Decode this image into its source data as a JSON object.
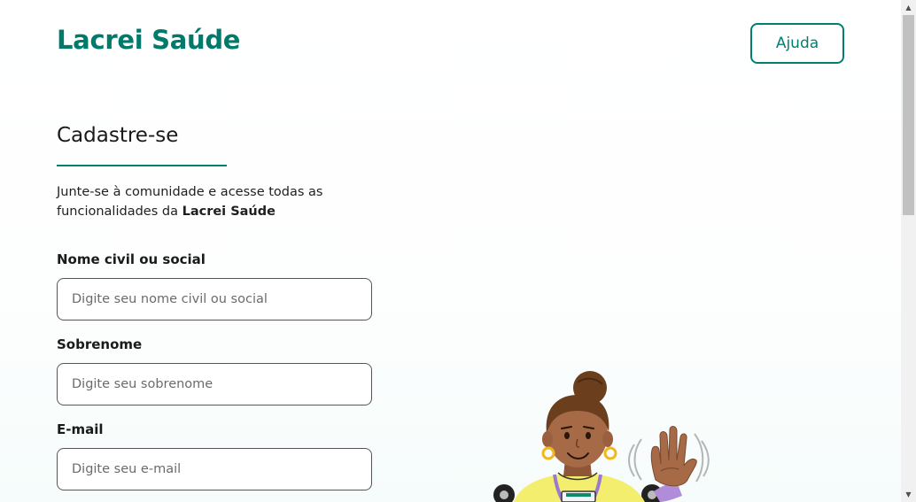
{
  "header": {
    "logo_text": "Lacrei Saúde",
    "help_label": "Ajuda"
  },
  "form": {
    "title": "Cadastre-se",
    "subtitle_prefix": "Junte-se à comunidade e acesse todas as funcionalidades da ",
    "subtitle_brand": "Lacrei Saúde",
    "fields": [
      {
        "label": "Nome civil ou social",
        "placeholder": "Digite seu nome civil ou social",
        "value": ""
      },
      {
        "label": "Sobrenome",
        "placeholder": "Digite seu sobrenome",
        "value": ""
      },
      {
        "label": "E-mail",
        "placeholder": "Digite seu e-mail",
        "value": ""
      }
    ]
  },
  "illustration": {
    "icon": "waving-person-illustration"
  },
  "colors": {
    "brand": "#007a6b",
    "accent_border": "#01806f",
    "skin": "#a66a47",
    "hair": "#6b3e1e",
    "shirt": "#f4ee6f",
    "earring": "#f2b81b",
    "sleeve": "#b08cd9"
  }
}
